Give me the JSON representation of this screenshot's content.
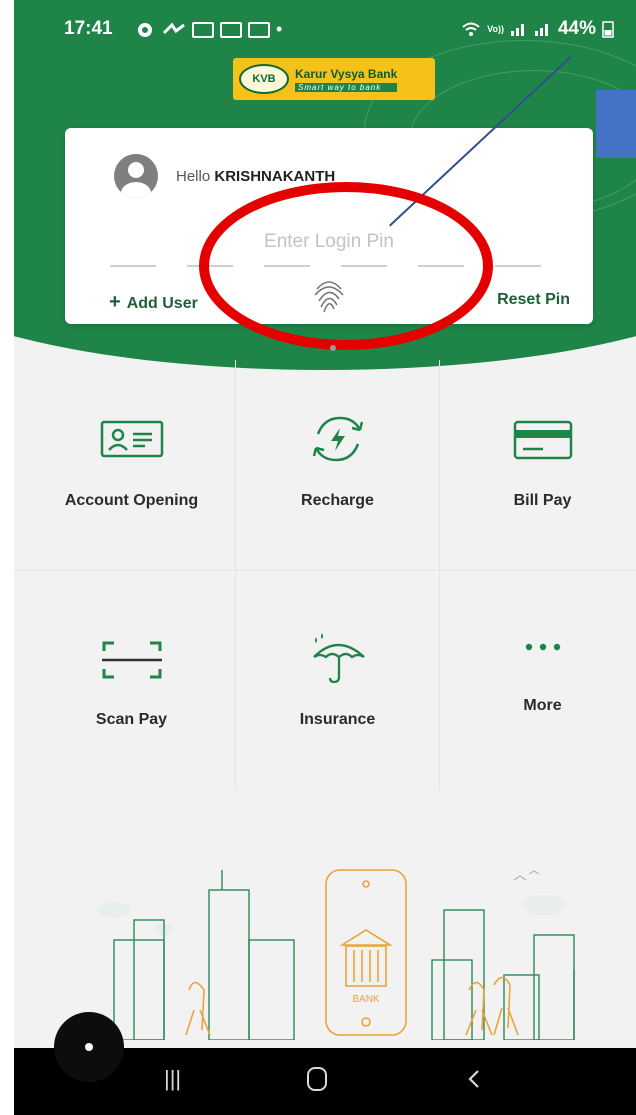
{
  "status_bar": {
    "time": "17:41",
    "battery": "44%",
    "network_label": "Vo))"
  },
  "logo": {
    "badge": "KVB",
    "name": "Karur Vysya Bank",
    "tagline": "Smart way to bank"
  },
  "login_card": {
    "greeting_prefix": "Hello ",
    "greeting_name": "KRISHNAKANTH",
    "pin_placeholder": "Enter Login Pin",
    "add_user_label": "Add User",
    "reset_pin_label": "Reset Pin"
  },
  "services": [
    {
      "label": "Account Opening",
      "icon": "id-card-icon"
    },
    {
      "label": "Recharge",
      "icon": "recharge-icon"
    },
    {
      "label": "Bill Pay",
      "icon": "card-icon"
    },
    {
      "label": "Scan Pay",
      "icon": "scan-icon"
    },
    {
      "label": "Insurance",
      "icon": "umbrella-icon"
    },
    {
      "label": "More",
      "icon": "more-dots-icon"
    }
  ],
  "illustration": {
    "bank_label": "BANK"
  },
  "colors": {
    "brand_green": "#1f8448",
    "annotation_red": "#e50000",
    "annotation_blue": "#4472c4"
  }
}
